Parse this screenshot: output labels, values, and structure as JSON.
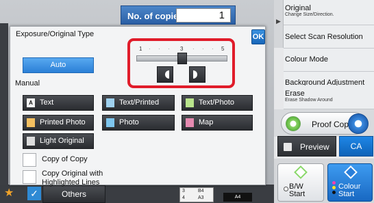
{
  "header": {
    "copies_label": "No. of copies",
    "copies_value": "1"
  },
  "right_panel": {
    "items": [
      {
        "label": "Original",
        "sub": "Change Size/Direction."
      },
      {
        "label": "Select Scan Resolution",
        "sub": ""
      },
      {
        "label": "Colour Mode",
        "sub": ""
      },
      {
        "label": "Background Adjustment",
        "sub": ""
      },
      {
        "label": "Erase",
        "sub": "Erase Shadow Around"
      }
    ],
    "proof_copy": "Proof Copy",
    "preview": "Preview",
    "ca": "CA",
    "bw_start": [
      "B/W",
      "Start"
    ],
    "colour_start": [
      "Colour",
      "Start"
    ]
  },
  "bottom": {
    "others": "Others",
    "tray_numbers": [
      "3",
      "4"
    ],
    "tray_sizes": [
      "B4",
      "A3"
    ],
    "paper_size": "A4"
  },
  "dialog": {
    "title": "Exposure/Original Type",
    "ok": "OK",
    "auto": "Auto",
    "manual": "Manual",
    "types": [
      {
        "label": "Text",
        "icon": "A"
      },
      {
        "label": "Text/Printed Photo",
        "icon": ""
      },
      {
        "label": "Text/Photo",
        "icon": ""
      },
      {
        "label": "Printed Photo",
        "icon": ""
      },
      {
        "label": "Photo",
        "icon": ""
      },
      {
        "label": "Map",
        "icon": ""
      },
      {
        "label": "Light Original",
        "icon": ""
      }
    ],
    "checks": [
      {
        "label": "Copy of Copy"
      },
      {
        "label": "Copy Original with Highlighted Lines"
      }
    ],
    "exposure": {
      "scale": [
        "1",
        "3",
        "5"
      ],
      "level": 3,
      "min": 1,
      "max": 5
    }
  },
  "colors": {
    "highlight": "#e01c2a",
    "accent": "#2b7fd6"
  }
}
